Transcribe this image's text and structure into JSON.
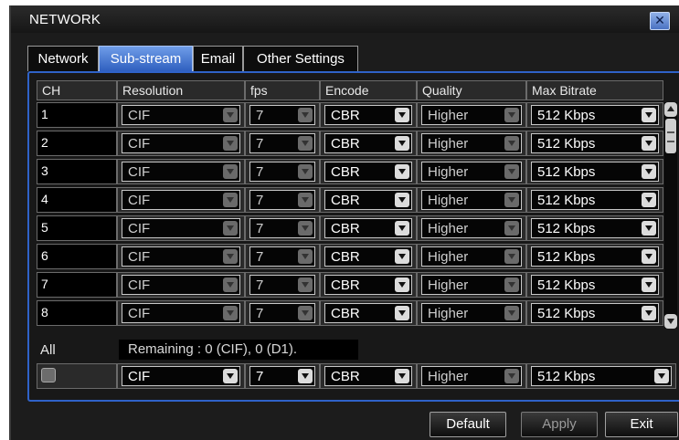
{
  "window": {
    "title": "NETWORK"
  },
  "tabs": [
    {
      "label": "Network",
      "active": false
    },
    {
      "label": "Sub-stream",
      "active": true
    },
    {
      "label": "Email",
      "active": false
    },
    {
      "label": "Other Settings",
      "active": false
    }
  ],
  "table": {
    "headers": [
      "CH",
      "Resolution",
      "fps",
      "Encode",
      "Quality",
      "Max Bitrate"
    ],
    "rows": [
      {
        "ch": "1",
        "resolution": "CIF",
        "fps": "7",
        "encode": "CBR",
        "quality": "Higher",
        "bitrate": "512 Kbps"
      },
      {
        "ch": "2",
        "resolution": "CIF",
        "fps": "7",
        "encode": "CBR",
        "quality": "Higher",
        "bitrate": "512 Kbps"
      },
      {
        "ch": "3",
        "resolution": "CIF",
        "fps": "7",
        "encode": "CBR",
        "quality": "Higher",
        "bitrate": "512 Kbps"
      },
      {
        "ch": "4",
        "resolution": "CIF",
        "fps": "7",
        "encode": "CBR",
        "quality": "Higher",
        "bitrate": "512 Kbps"
      },
      {
        "ch": "5",
        "resolution": "CIF",
        "fps": "7",
        "encode": "CBR",
        "quality": "Higher",
        "bitrate": "512 Kbps"
      },
      {
        "ch": "6",
        "resolution": "CIF",
        "fps": "7",
        "encode": "CBR",
        "quality": "Higher",
        "bitrate": "512 Kbps"
      },
      {
        "ch": "7",
        "resolution": "CIF",
        "fps": "7",
        "encode": "CBR",
        "quality": "Higher",
        "bitrate": "512 Kbps"
      },
      {
        "ch": "8",
        "resolution": "CIF",
        "fps": "7",
        "encode": "CBR",
        "quality": "Higher",
        "bitrate": "512 Kbps"
      }
    ]
  },
  "all_row": {
    "label": "All",
    "remaining": "Remaining : 0 (CIF), 0 (D1).",
    "checked": false,
    "resolution": "CIF",
    "fps": "7",
    "encode": "CBR",
    "quality": "Higher",
    "bitrate": "512 Kbps"
  },
  "buttons": {
    "default": "Default",
    "apply": "Apply",
    "exit": "Exit"
  },
  "colors": {
    "accent_blue": "#2f62c8",
    "active_tab": "#4a7fd6",
    "background": "#1c1c1c"
  },
  "icons": {
    "close": "close-x-icon",
    "dropdown": "chevron-down-icon",
    "scroll_up": "scroll-up-icon",
    "scroll_down": "scroll-down-icon"
  }
}
